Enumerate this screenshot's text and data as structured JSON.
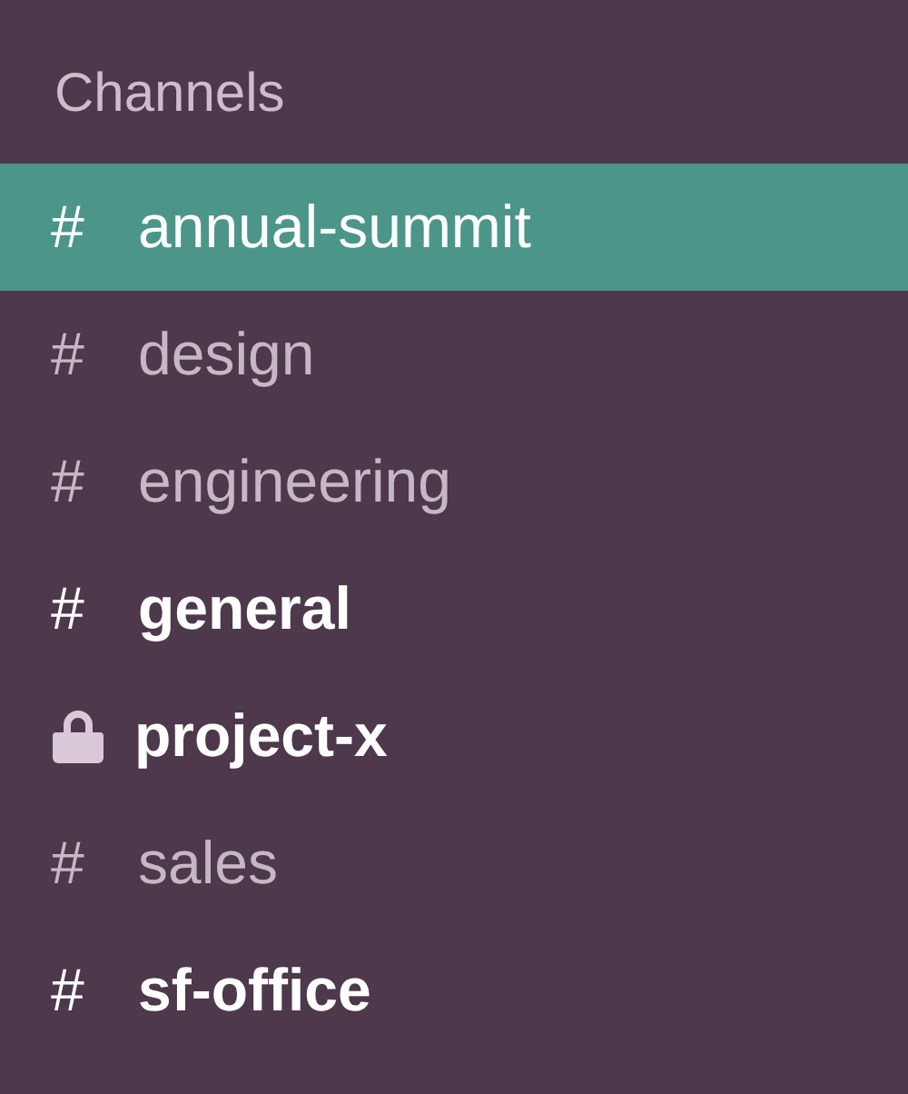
{
  "sidebar": {
    "heading": "Channels",
    "channels": [
      {
        "kind": "public",
        "symbol": "#",
        "name": "annual-summit",
        "selected": true,
        "unread": false
      },
      {
        "kind": "public",
        "symbol": "#",
        "name": "design",
        "selected": false,
        "unread": false
      },
      {
        "kind": "public",
        "symbol": "#",
        "name": "engineering",
        "selected": false,
        "unread": false
      },
      {
        "kind": "public",
        "symbol": "#",
        "name": "general",
        "selected": false,
        "unread": true
      },
      {
        "kind": "private",
        "name": "project-x",
        "selected": false,
        "unread": true
      },
      {
        "kind": "public",
        "symbol": "#",
        "name": "sales",
        "selected": false,
        "unread": false
      },
      {
        "kind": "public",
        "symbol": "#",
        "name": "sf-office",
        "selected": false,
        "unread": true
      }
    ]
  }
}
